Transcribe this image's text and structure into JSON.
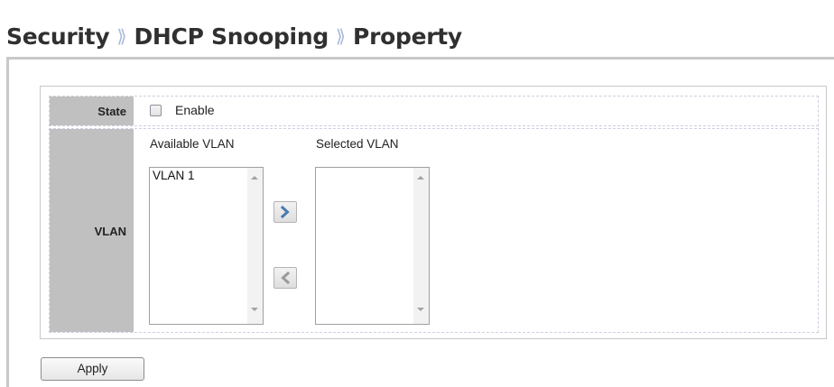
{
  "breadcrumb": {
    "items": [
      "Security",
      "DHCP Snooping",
      "Property"
    ],
    "separator": "⟫"
  },
  "state": {
    "label": "State",
    "checkbox_label": "Enable",
    "enabled": false
  },
  "vlan": {
    "label": "VLAN",
    "available_title": "Available VLAN",
    "selected_title": "Selected VLAN",
    "available_items": [
      "VLAN 1"
    ],
    "selected_items": [],
    "add_icon": "chevron-right-icon",
    "remove_icon": "chevron-left-icon"
  },
  "actions": {
    "apply_label": "Apply"
  },
  "colors": {
    "label_bg": "#c0c0c0",
    "separator": "#a8b8d8",
    "arrow_enabled": "#4a7ab0",
    "arrow_disabled": "#9a9a9a"
  }
}
